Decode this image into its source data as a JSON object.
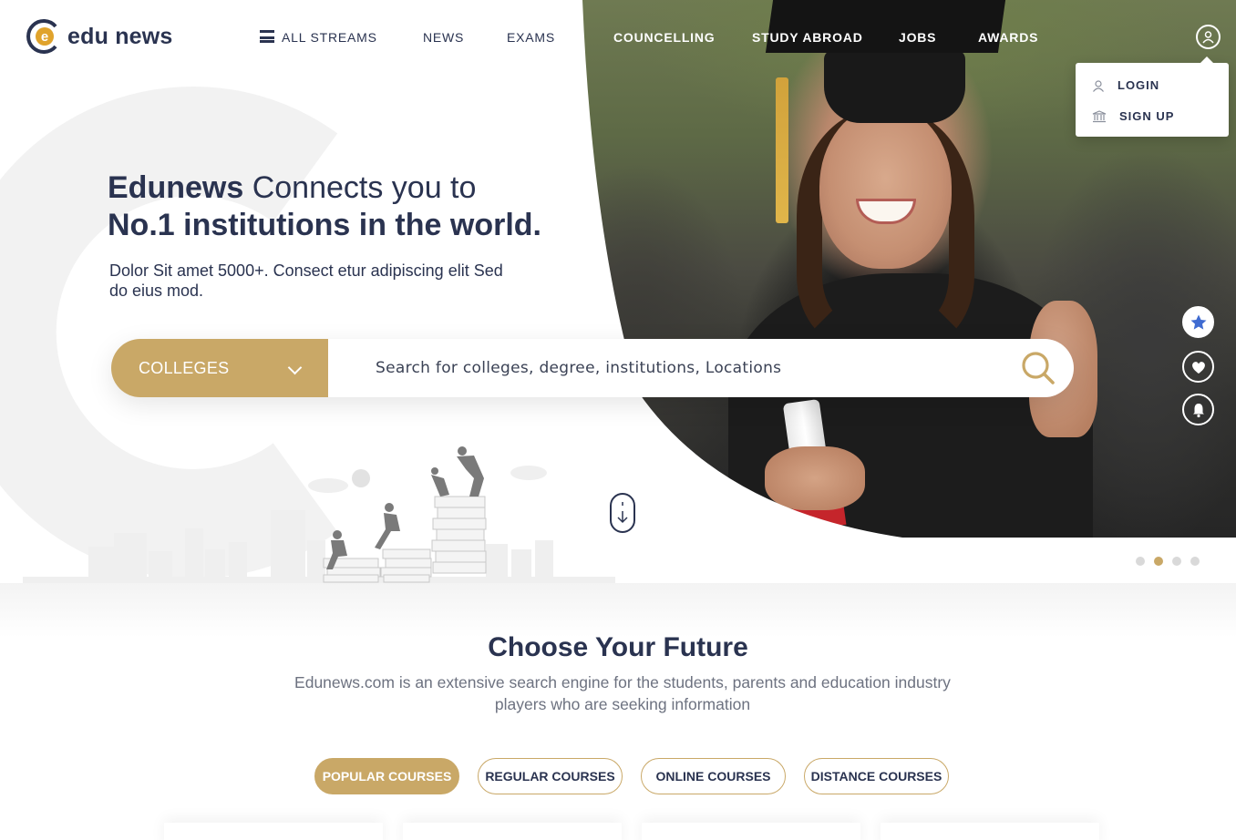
{
  "brand": {
    "name": "edu news",
    "accent": "#c9a867",
    "navy": "#2a3350"
  },
  "nav": {
    "all_streams": "ALL STREAMS",
    "news": "NEWS",
    "exams": "EXAMS",
    "councelling": "COUNCELLING",
    "study_abroad": "STUDY ABROAD",
    "jobs": "JOBS",
    "awards": "AWARDS"
  },
  "user_menu": {
    "login": "LOGIN",
    "signup": "SIGN UP"
  },
  "hero": {
    "headline_bold": "Edunews",
    "headline_rest": " Connects you to",
    "headline_line2": "No.1 institutions in the world.",
    "subline": "Dolor Sit amet 5000+. Consect etur adipiscing elit Sed do eius mod."
  },
  "search": {
    "category": "COLLEGES",
    "placeholder": "Search for colleges, degree, institutions, Locations"
  },
  "side_icons": [
    "star-icon",
    "heart-icon",
    "bell-icon"
  ],
  "slider": {
    "count": 4,
    "active_index": 1
  },
  "future": {
    "title": "Choose Your Future",
    "description": "Edunews.com is an extensive search engine for the students, parents and education industry players who are seeking information",
    "tabs": [
      {
        "label": "POPULAR COURSES",
        "active": true
      },
      {
        "label": "REGULAR COURSES",
        "active": false
      },
      {
        "label": "ONLINE COURSES",
        "active": false
      },
      {
        "label": "DISTANCE COURSES",
        "active": false
      }
    ]
  }
}
